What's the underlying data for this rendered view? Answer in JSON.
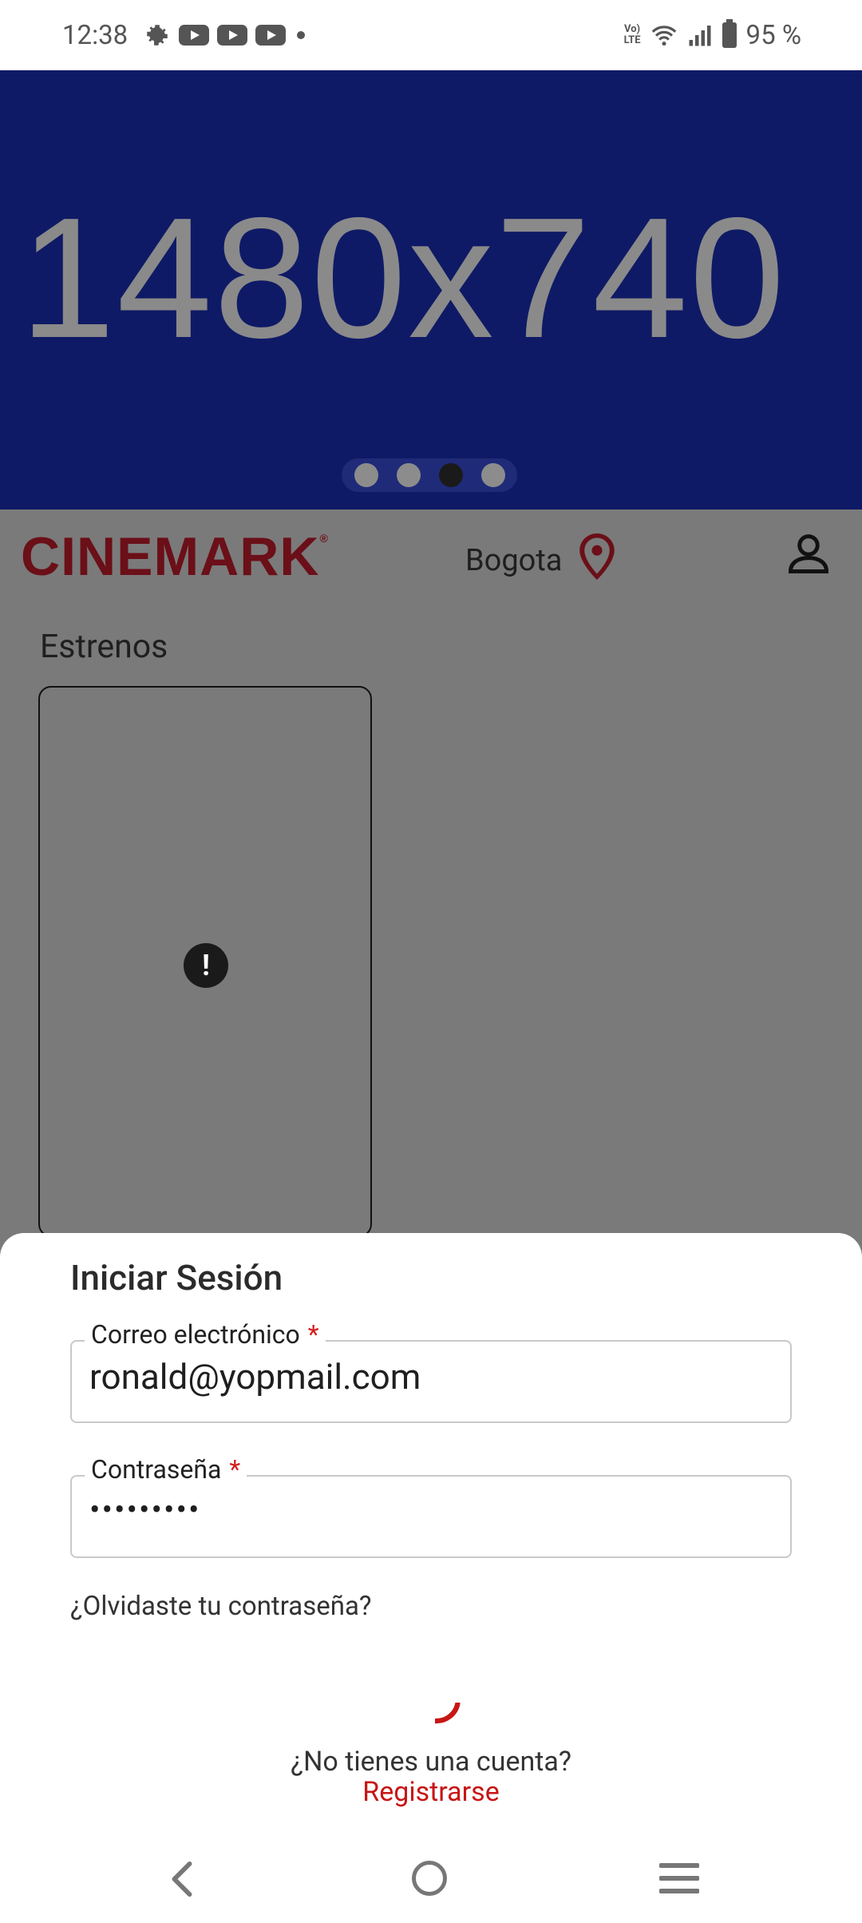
{
  "status_bar": {
    "time": "12:38",
    "battery": "95 %",
    "network_label": "Vo) LTE"
  },
  "banner": {
    "placeholder_text": "1480x740",
    "slides": 4,
    "active_slide": 3
  },
  "header": {
    "logo_text": "CINEMARK",
    "city": "Bogota"
  },
  "main": {
    "section_title": "Estrenos",
    "poster_warning_icon": "!"
  },
  "login": {
    "title": "Iniciar Sesión",
    "email_label": "Correo electrónico",
    "email_value": "ronald@yopmail.com",
    "password_label": "Contraseña",
    "password_value": "•••••••••",
    "required_mark": "*",
    "forgot": "¿Olvidaste tu contraseña?",
    "no_account": "¿No tienes una cuenta?",
    "register": "Registrarse"
  },
  "colors": {
    "banner": "#0f1a66",
    "brand": "#c81515",
    "overlay": "#7a7a7a"
  }
}
